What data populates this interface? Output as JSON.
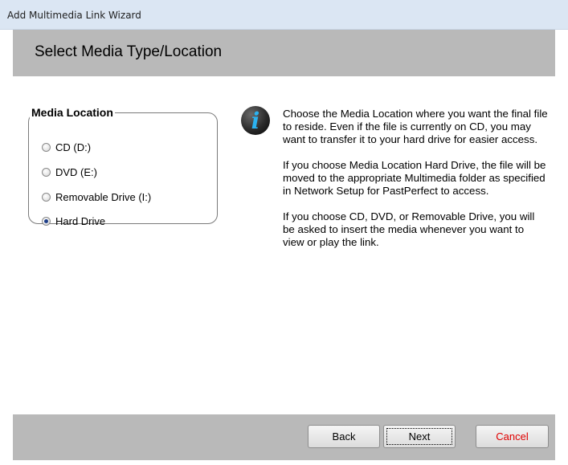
{
  "window": {
    "title": "Add Multimedia Link Wizard"
  },
  "header": {
    "title": "Select Media Type/Location"
  },
  "media_location": {
    "legend": "Media Location",
    "options": [
      {
        "label": "CD (D:)",
        "checked": false
      },
      {
        "label": "DVD (E:)",
        "checked": false
      },
      {
        "label": "Removable Drive (I:)",
        "checked": false
      },
      {
        "label": "Hard Drive",
        "checked": true
      }
    ]
  },
  "info": {
    "icon": "info-icon",
    "paragraphs": [
      "Choose the Media Location where you want the final file to reside.  Even if the file is currently on CD, you may want to transfer it to your hard drive for easier access.",
      "If you choose Media Location Hard Drive, the file will be moved to the appropriate Multimedia folder as specified in Network Setup for PastPerfect to access.",
      "If you choose CD, DVD, or Removable Drive, you will be asked to insert the media whenever you want to view or play the link."
    ]
  },
  "footer": {
    "back_label": "Back",
    "next_label": "Next",
    "cancel_label": "Cancel"
  },
  "colors": {
    "titlebar": "#dbe6f3",
    "band": "#b9b9b9",
    "cancel_text": "#e00000",
    "info_glyph": "#2bb2f0"
  }
}
